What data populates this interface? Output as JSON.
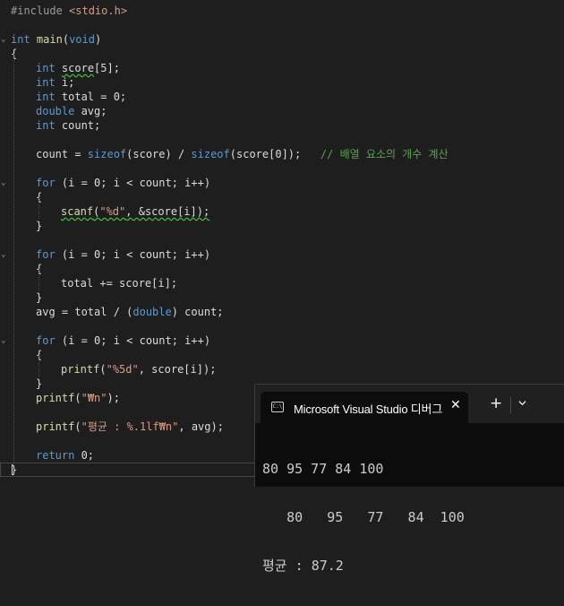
{
  "editor": {
    "include_directive": "#include",
    "include_file": "<stdio.h>",
    "main_sig": "int main(void)",
    "comment_count": "// 배열 요소의 개수 계산"
  },
  "terminal": {
    "title": "Microsoft Visual Studio 디버그 ...",
    "tab_title": "Microsoft Visual Studio 디버그",
    "icon_glyph": "C:\\",
    "output_lines": [
      "80 95 77 84 100",
      "   80   95   77   84  100",
      "평균 : 87.2"
    ]
  }
}
